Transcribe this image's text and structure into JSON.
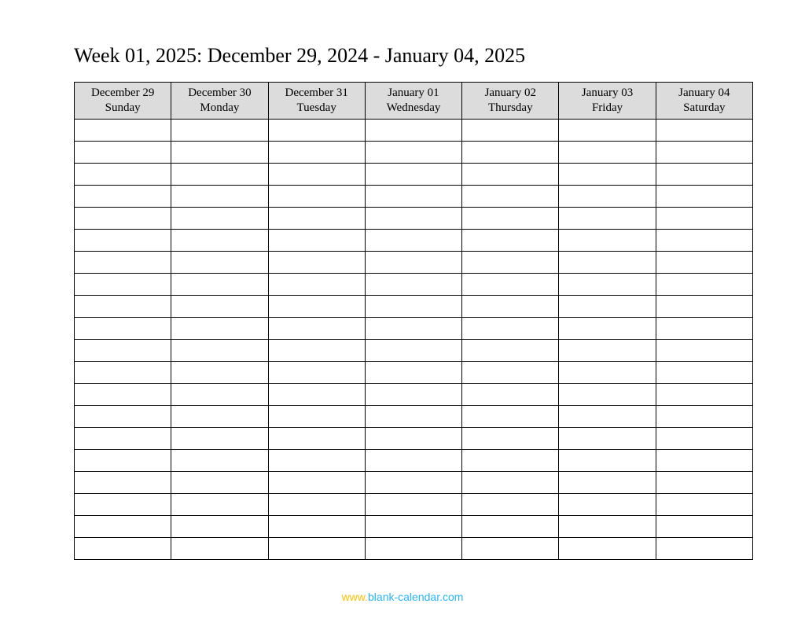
{
  "title": "Week 01, 2025: December 29, 2024 - January 04, 2025",
  "days": [
    {
      "date": "December 29",
      "weekday": "Sunday"
    },
    {
      "date": "December 30",
      "weekday": "Monday"
    },
    {
      "date": "December 31",
      "weekday": "Tuesday"
    },
    {
      "date": "January 01",
      "weekday": "Wednesday"
    },
    {
      "date": "January 02",
      "weekday": "Thursday"
    },
    {
      "date": "January 03",
      "weekday": "Friday"
    },
    {
      "date": "January 04",
      "weekday": "Saturday"
    }
  ],
  "row_count": 20,
  "footer": {
    "prefix": "www.",
    "domain": "blank-calendar.com"
  }
}
